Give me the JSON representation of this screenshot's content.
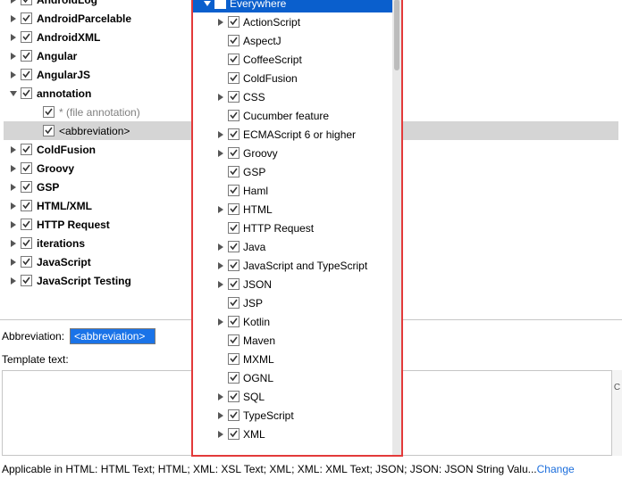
{
  "tree": {
    "items": [
      {
        "expander": "right",
        "checked": true,
        "bold": true,
        "indent": 1,
        "label": "AndroidLog",
        "topcut": true
      },
      {
        "expander": "right",
        "checked": true,
        "bold": true,
        "indent": 1,
        "label": "AndroidParcelable"
      },
      {
        "expander": "right",
        "checked": true,
        "bold": true,
        "indent": 1,
        "label": "AndroidXML"
      },
      {
        "expander": "right",
        "checked": true,
        "bold": true,
        "indent": 1,
        "label": "Angular"
      },
      {
        "expander": "right",
        "checked": true,
        "bold": true,
        "indent": 1,
        "label": "AngularJS"
      },
      {
        "expander": "down",
        "checked": true,
        "bold": true,
        "indent": 1,
        "label": "annotation"
      },
      {
        "expander": "blank",
        "checked": true,
        "bold": false,
        "indent": 2,
        "label": "* (file annotation)",
        "gray": true
      },
      {
        "expander": "blank",
        "checked": true,
        "bold": false,
        "indent": 2,
        "label": "<abbreviation>",
        "selected": true
      },
      {
        "expander": "right",
        "checked": true,
        "bold": true,
        "indent": 1,
        "label": "ColdFusion"
      },
      {
        "expander": "right",
        "checked": true,
        "bold": true,
        "indent": 1,
        "label": "Groovy"
      },
      {
        "expander": "right",
        "checked": true,
        "bold": true,
        "indent": 1,
        "label": "GSP"
      },
      {
        "expander": "right",
        "checked": true,
        "bold": true,
        "indent": 1,
        "label": "HTML/XML"
      },
      {
        "expander": "right",
        "checked": true,
        "bold": true,
        "indent": 1,
        "label": "HTTP Request"
      },
      {
        "expander": "right",
        "checked": true,
        "bold": true,
        "indent": 1,
        "label": "iterations"
      },
      {
        "expander": "right",
        "checked": true,
        "bold": true,
        "indent": 1,
        "label": "JavaScript"
      },
      {
        "expander": "right",
        "checked": true,
        "bold": true,
        "indent": 1,
        "label": "JavaScript Testing"
      }
    ]
  },
  "popup": {
    "header": {
      "label": "Everywhere",
      "expander": "down",
      "checked": true
    },
    "items": [
      {
        "expander": "right",
        "label": "ActionScript"
      },
      {
        "expander": "blank",
        "label": "AspectJ"
      },
      {
        "expander": "blank",
        "label": "CoffeeScript"
      },
      {
        "expander": "blank",
        "label": "ColdFusion"
      },
      {
        "expander": "right",
        "label": "CSS"
      },
      {
        "expander": "blank",
        "label": "Cucumber feature"
      },
      {
        "expander": "right",
        "label": "ECMAScript 6 or higher"
      },
      {
        "expander": "right",
        "label": "Groovy"
      },
      {
        "expander": "blank",
        "label": "GSP"
      },
      {
        "expander": "blank",
        "label": "Haml"
      },
      {
        "expander": "right",
        "label": "HTML"
      },
      {
        "expander": "blank",
        "label": "HTTP Request"
      },
      {
        "expander": "right",
        "label": "Java"
      },
      {
        "expander": "right",
        "label": "JavaScript and TypeScript"
      },
      {
        "expander": "right",
        "label": "JSON"
      },
      {
        "expander": "blank",
        "label": "JSP"
      },
      {
        "expander": "right",
        "label": "Kotlin"
      },
      {
        "expander": "blank",
        "label": "Maven"
      },
      {
        "expander": "blank",
        "label": "MXML"
      },
      {
        "expander": "blank",
        "label": "OGNL"
      },
      {
        "expander": "right",
        "label": "SQL"
      },
      {
        "expander": "right",
        "label": "TypeScript"
      },
      {
        "expander": "right",
        "label": "XML"
      }
    ]
  },
  "bottom": {
    "abbreviation_label": "Abbreviation:",
    "abbreviation_value": "<abbreviation>",
    "template_text_label": "Template text:",
    "right_strip_char": "C",
    "applicable_text": "Applicable in HTML: HTML Text; HTML; XML: XSL Text; XML; XML: XML Text; JSON; JSON: JSON String Valu...",
    "change_label": "Change"
  }
}
